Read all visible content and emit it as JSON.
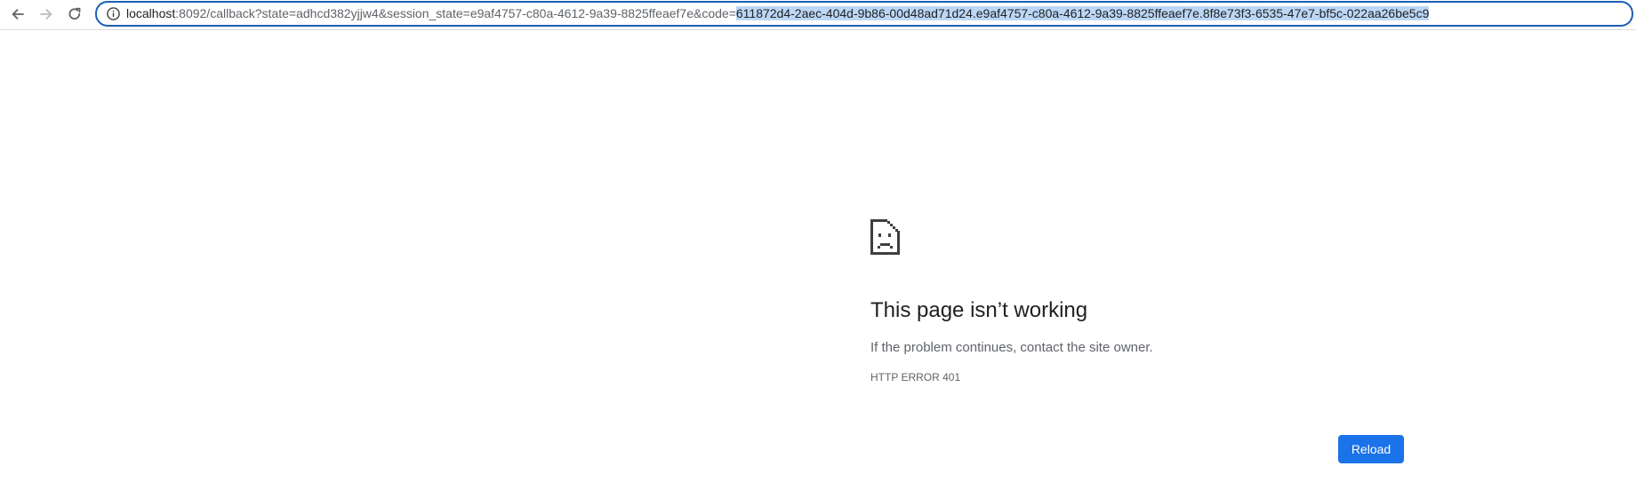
{
  "browser": {
    "url": {
      "host": "localhost",
      "rest": ":8092/callback?state=adhcd382yjjw4&session_state=e9af4757-c80a-4612-9a39-8825ffeaef7e&code=",
      "selected": "611872d4-2aec-404d-9b86-00d48ad71d24.e9af4757-c80a-4612-9a39-8825ffeaef7e.8f8e73f3-6535-47e7-bf5c-022aa26be5c9"
    },
    "icons": {
      "back": "back-arrow-icon",
      "forward": "forward-arrow-icon",
      "reload": "reload-icon",
      "site_info": "info-icon"
    },
    "colors": {
      "omnibox_border": "#1a5fb4",
      "selection": "#bcd7f5"
    }
  },
  "error_page": {
    "icon": "sad-document-icon",
    "title": "This page isn’t working",
    "description": "If the problem continues, contact the site owner.",
    "error_code": "HTTP ERROR 401",
    "reload_label": "Reload",
    "colors": {
      "button": "#1a73e8",
      "title": "#202124",
      "text": "#5f6368"
    }
  }
}
